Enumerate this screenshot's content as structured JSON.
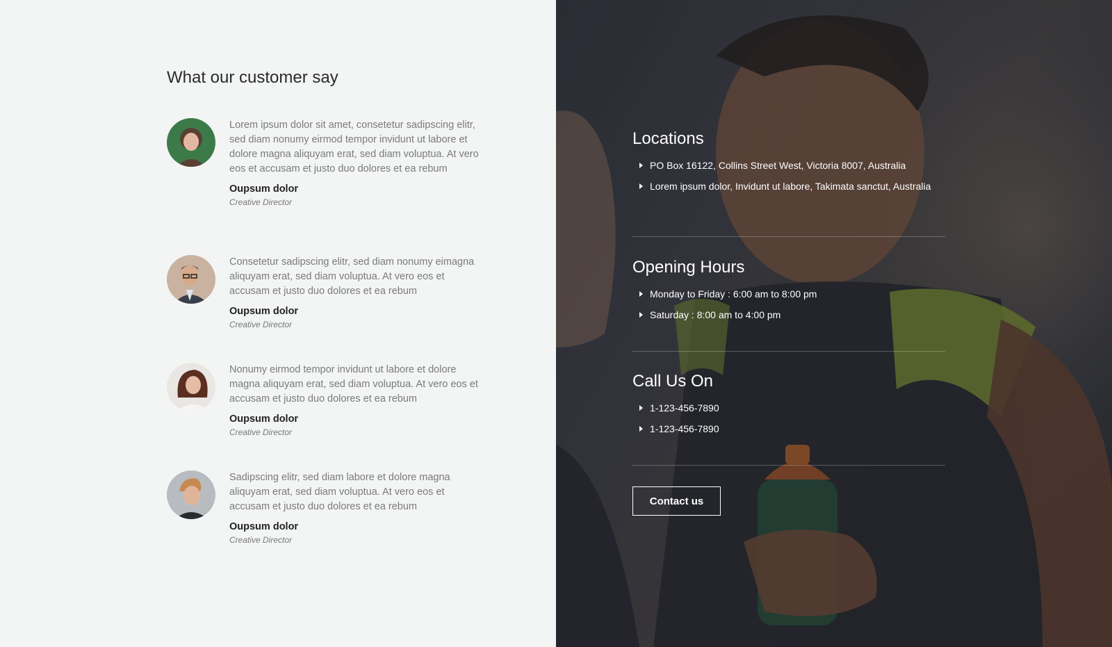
{
  "testimonials": {
    "heading": "What our customer say",
    "items": [
      {
        "quote": "Lorem ipsum dolor sit amet, consetetur sadipscing elitr, sed diam nonumy eirmod tempor invidunt ut labore et dolore magna aliquyam erat, sed diam voluptua. At vero eos et accusam et justo duo dolores et ea rebum",
        "name": "Oupsum dolor",
        "role": "Creative Director"
      },
      {
        "quote": "Consetetur sadipscing elitr, sed diam nonumy eimagna aliquyam erat, sed diam voluptua. At vero eos et accusam et justo duo dolores et ea rebum",
        "name": "Oupsum dolor",
        "role": "Creative Director"
      },
      {
        "quote": "Nonumy eirmod tempor invidunt ut labore et dolore magna aliquyam erat, sed diam voluptua. At vero eos et accusam et justo duo dolores et ea rebum",
        "name": "Oupsum dolor",
        "role": "Creative Director"
      },
      {
        "quote": "Sadipscing elitr, sed diam labore et dolore magna aliquyam erat, sed diam voluptua. At vero eos et accusam et justo duo dolores et ea rebum",
        "name": "Oupsum dolor",
        "role": "Creative Director"
      }
    ]
  },
  "info": {
    "locations": {
      "title": "Locations",
      "items": [
        "PO Box 16122, Collins Street West, Victoria 8007, Australia",
        "Lorem ipsum dolor, Invidunt ut labore, Takimata sanctut, Australia"
      ]
    },
    "hours": {
      "title": "Opening Hours",
      "items": [
        "Monday to Friday : 6:00 am to 8:00 pm",
        "Saturday : 8:00 am to 4:00 pm"
      ]
    },
    "call": {
      "title": "Call Us On",
      "items": [
        "1-123-456-7890",
        "1-123-456-7890"
      ]
    },
    "contact_label": "Contact us"
  },
  "colors": {
    "accent_bg": "#f3f5f4",
    "text_dark": "#222222",
    "text_muted": "#7a7a7a"
  }
}
